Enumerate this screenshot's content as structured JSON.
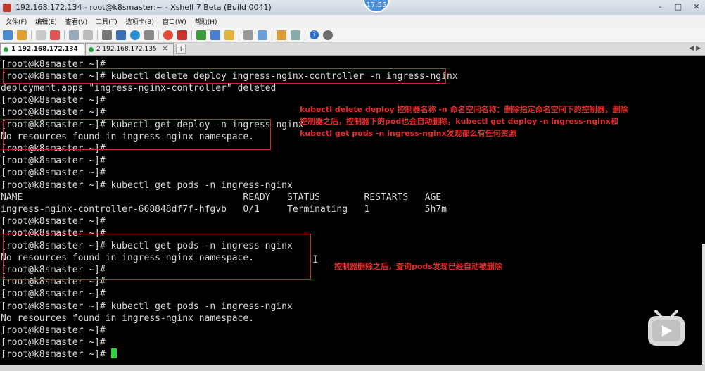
{
  "window": {
    "title": "192.168.172.134 - root@k8smaster:~ - Xshell 7 Beta (Build 0041)",
    "clock": "17:55"
  },
  "menu": [
    "文件(F)",
    "编辑(E)",
    "查看(V)",
    "工具(T)",
    "选项卡(B)",
    "窗口(W)",
    "帮助(H)"
  ],
  "tabs": [
    {
      "label": "1 192.168.172.134",
      "active": true
    },
    {
      "label": "2 192.168.172.135",
      "active": false
    }
  ],
  "terminal": {
    "lines": [
      "[root@k8smaster ~]#",
      "[root@k8smaster ~]# kubectl delete deploy ingress-nginx-controller -n ingress-nginx",
      "deployment.apps \"ingress-nginx-controller\" deleted",
      "[root@k8smaster ~]#",
      "[root@k8smaster ~]#",
      "[root@k8smaster ~]# kubectl get deploy -n ingress-nginx",
      "No resources found in ingress-nginx namespace.",
      "[root@k8smaster ~]#",
      "[root@k8smaster ~]#",
      "[root@k8smaster ~]#",
      "[root@k8smaster ~]# kubectl get pods -n ingress-nginx",
      "NAME                                        READY   STATUS        RESTARTS   AGE",
      "ingress-nginx-controller-668848df7f-hfgvb   0/1     Terminating   1          5h7m",
      "[root@k8smaster ~]#",
      "[root@k8smaster ~]#",
      "[root@k8smaster ~]# kubectl get pods -n ingress-nginx",
      "No resources found in ingress-nginx namespace.",
      "[root@k8smaster ~]#",
      "[root@k8smaster ~]#",
      "[root@k8smaster ~]#",
      "[root@k8smaster ~]# kubectl get pods -n ingress-nginx",
      "No resources found in ingress-nginx namespace.",
      "[root@k8smaster ~]#",
      "[root@k8smaster ~]#",
      "[root@k8smaster ~]#"
    ]
  },
  "annotations": {
    "note1": [
      "kubectl delete deploy 控制器名称 -n 命名空间名称：删除指定命名空间下的控制器，删除",
      "控制器之后，控制器下的pod也会自动删除，kubectl get deploy -n ingress-nginx和",
      "kubectl get pods -n ingress-nginx发现都么有任何资源"
    ],
    "note2": "控制器删除之后，查询pods发现已经自动被删除"
  },
  "colors": {
    "annotation": "#e62b2b",
    "cursor": "#2fd13a",
    "terminal_text": "#d8d8d8"
  }
}
